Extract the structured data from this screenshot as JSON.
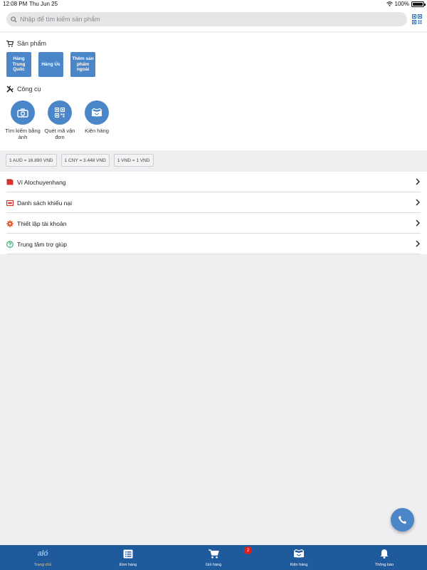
{
  "status_bar": {
    "time": "12:08 PM",
    "date": "Thu Jun 25",
    "battery": "100%"
  },
  "search": {
    "placeholder": "Nhập để tìm kiếm sản phẩm"
  },
  "products": {
    "title": "Sản phẩm",
    "items": [
      {
        "label": "Hàng Trung Quốc"
      },
      {
        "label": "Hàng Úc"
      },
      {
        "label": "Thêm sản phẩm ngoài"
      }
    ]
  },
  "tools": {
    "title": "Công cụ",
    "items": [
      {
        "label": "Tìm kiếm bằng ảnh",
        "icon": "camera-icon"
      },
      {
        "label": "Quét mã vận đơn",
        "icon": "qr-code-icon"
      },
      {
        "label": "Kiện hàng",
        "icon": "package-icon"
      }
    ]
  },
  "rates": [
    "1 AUD = 16.890 VND",
    "1 CNY = 3.448 VND",
    "1 VND = 1 VND"
  ],
  "menu": [
    {
      "label": "Ví Alochuyenhang",
      "icon": "wallet-icon",
      "color": "#d9342b"
    },
    {
      "label": "Danh sách khiếu nại",
      "icon": "complaint-icon",
      "color": "#d9342b"
    },
    {
      "label": "Thiết lập tài khoản",
      "icon": "settings-icon",
      "color": "#e8552a"
    },
    {
      "label": "Trung tâm trợ giúp",
      "icon": "help-icon",
      "color": "#2aa76a"
    }
  ],
  "tabbar": {
    "logo": "aló",
    "items": [
      {
        "label": "Trang chủ",
        "active": true
      },
      {
        "label": "Đơn hàng"
      },
      {
        "label": "Giỏ hàng",
        "badge": "2"
      },
      {
        "label": "Kiện hàng"
      },
      {
        "label": "Thông báo"
      }
    ]
  },
  "colors": {
    "primary": "#4a86c8",
    "tabbar": "#1f5a9d",
    "active_tab": "#f5c96a",
    "badge": "#e02020"
  }
}
